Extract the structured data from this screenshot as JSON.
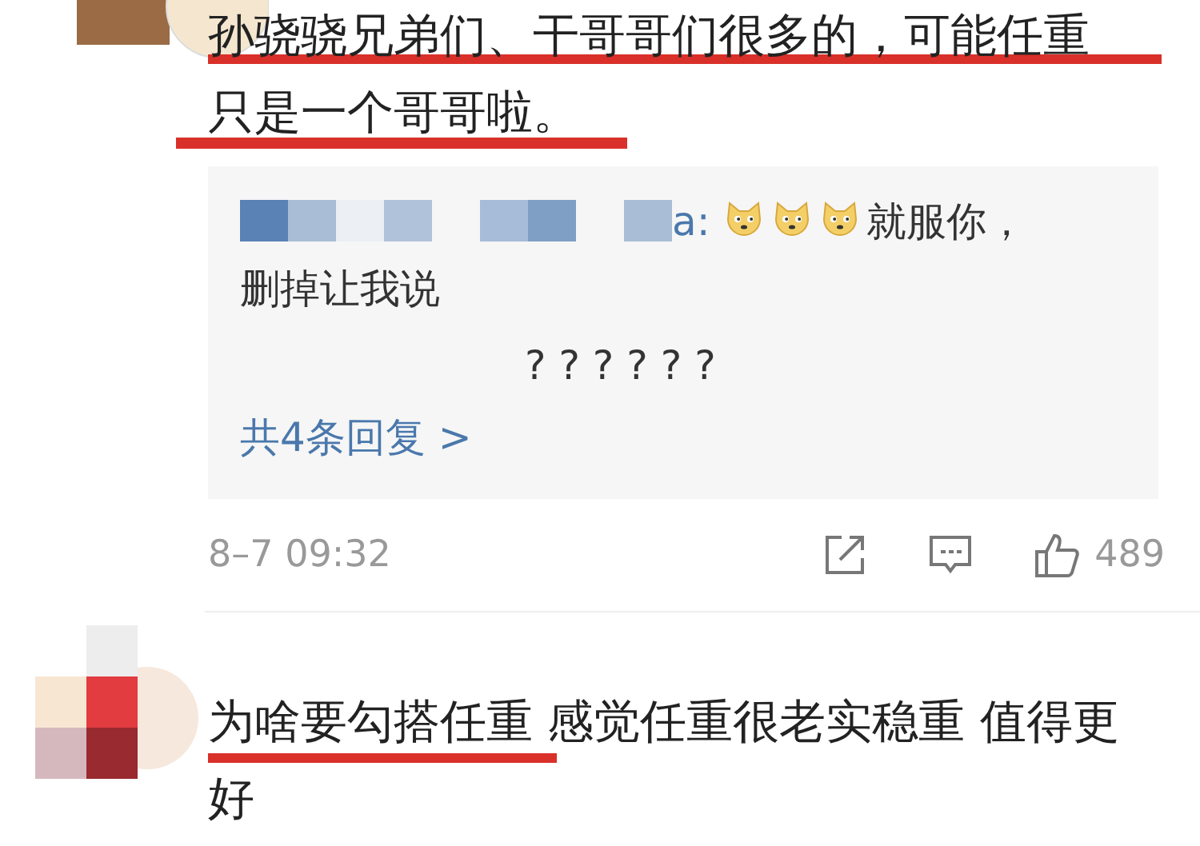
{
  "comments": [
    {
      "text": "孙骁骁兄弟们、干哥哥们很多的，可能任重只是一个哥哥啦。",
      "replies": {
        "items": [
          {
            "author_tail": "a:",
            "text": "就服你，删掉让我说"
          },
          {
            "text": "? ? ? ? ? ?"
          }
        ],
        "more": "共4条回复 >"
      },
      "time": "8–7 09:32",
      "likes": "489"
    },
    {
      "text": "为啥要勾搭任重 感觉任重很老实稳重 值得更好"
    }
  ]
}
